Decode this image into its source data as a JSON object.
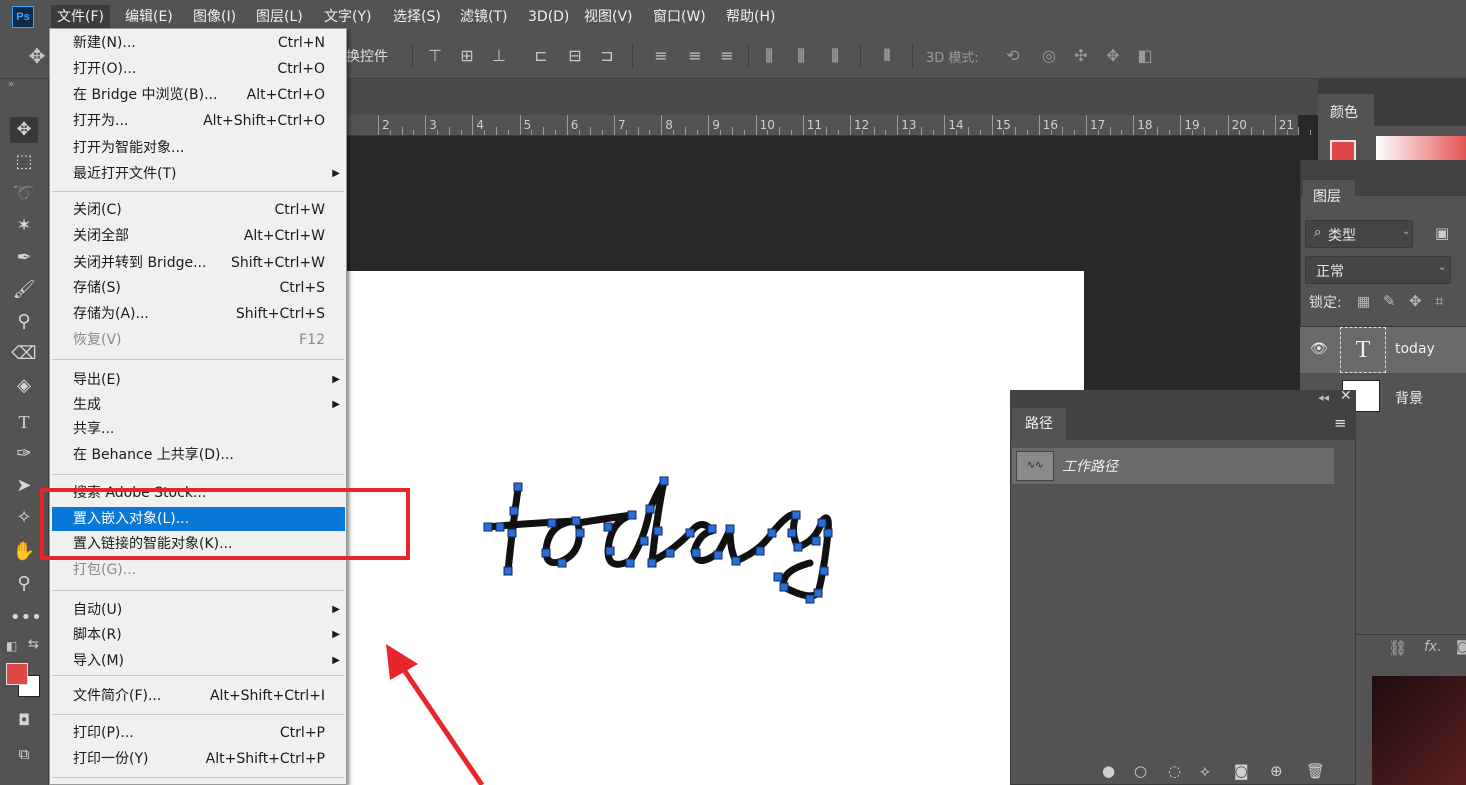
{
  "app": {
    "logo_text": "Ps"
  },
  "menubar": {
    "items": [
      "文件(F)",
      "编辑(E)",
      "图像(I)",
      "图层(L)",
      "文字(Y)",
      "选择(S)",
      "滤镜(T)",
      "3D(D)",
      "视图(V)",
      "窗口(W)",
      "帮助(H)"
    ]
  },
  "optionsbar": {
    "transform_label": "换控件",
    "mode_3d_label": "3D 模式:"
  },
  "ruler": {
    "labels": [
      "2",
      "3",
      "4",
      "5",
      "6",
      "7",
      "8",
      "9",
      "10",
      "11",
      "12",
      "13",
      "14",
      "15",
      "16",
      "17",
      "18",
      "19",
      "20",
      "21"
    ]
  },
  "canvas": {
    "word": "today"
  },
  "file_menu": {
    "items": [
      {
        "label": "新建(N)...",
        "shortcut": "Ctrl+N"
      },
      {
        "label": "打开(O)...",
        "shortcut": "Ctrl+O"
      },
      {
        "label": "在 Bridge 中浏览(B)...",
        "shortcut": "Alt+Ctrl+O"
      },
      {
        "label": "打开为...",
        "shortcut": "Alt+Shift+Ctrl+O"
      },
      {
        "label": "打开为智能对象...",
        "shortcut": ""
      },
      {
        "label": "最近打开文件(T)",
        "shortcut": "",
        "submenu": true
      },
      {
        "label": "关闭(C)",
        "shortcut": "Ctrl+W"
      },
      {
        "label": "关闭全部",
        "shortcut": "Alt+Ctrl+W"
      },
      {
        "label": "关闭并转到 Bridge...",
        "shortcut": "Shift+Ctrl+W"
      },
      {
        "label": "存储(S)",
        "shortcut": "Ctrl+S"
      },
      {
        "label": "存储为(A)...",
        "shortcut": "Shift+Ctrl+S"
      },
      {
        "label": "恢复(V)",
        "shortcut": "F12",
        "disabled": true
      },
      {
        "label": "导出(E)",
        "shortcut": "",
        "submenu": true
      },
      {
        "label": "生成",
        "shortcut": "",
        "submenu": true
      },
      {
        "label": "共享...",
        "shortcut": ""
      },
      {
        "label": "在 Behance 上共享(D)...",
        "shortcut": ""
      },
      {
        "label": "搜索 Adobe Stock...",
        "shortcut": ""
      },
      {
        "label": "置入嵌入对象(L)...",
        "shortcut": "",
        "highlighted": true
      },
      {
        "label": "置入链接的智能对象(K)...",
        "shortcut": ""
      },
      {
        "label": "打包(G)...",
        "shortcut": "",
        "disabled": true
      },
      {
        "label": "自动(U)",
        "shortcut": "",
        "submenu": true
      },
      {
        "label": "脚本(R)",
        "shortcut": "",
        "submenu": true
      },
      {
        "label": "导入(M)",
        "shortcut": "",
        "submenu": true
      },
      {
        "label": "文件简介(F)...",
        "shortcut": "Alt+Shift+Ctrl+I"
      },
      {
        "label": "打印(P)...",
        "shortcut": "Ctrl+P"
      },
      {
        "label": "打印一份(Y)",
        "shortcut": "Alt+Shift+Ctrl+P"
      }
    ]
  },
  "color_panel": {
    "tab": "颜色",
    "fg_color": "#e04848"
  },
  "layers_panel": {
    "tab": "图层",
    "filter_label": "类型",
    "blend_mode": "正常",
    "lock_label": "锁定:",
    "layers": [
      {
        "name": "today",
        "type": "text"
      },
      {
        "name": "背景",
        "type": "background"
      }
    ]
  },
  "paths_panel": {
    "tab": "路径",
    "paths": [
      {
        "name": "工作路径"
      }
    ]
  },
  "colors": {
    "accent": "#0a78d7",
    "annotation": "#e8252b",
    "path_anchor": "#2a6fd8"
  }
}
